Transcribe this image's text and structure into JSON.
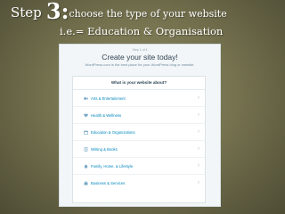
{
  "slide": {
    "step_word": "Step",
    "step_number": "3",
    "step_colon": ":",
    "title_rest": "choose the type of your website",
    "subtitle": "i.e.= Education & Organisation"
  },
  "screenshot": {
    "step_label": "Step 1 of 4",
    "heading": "Create your site today!",
    "tagline": "WordPress.com is the best place for your WordPress blog or website.",
    "question": "What is your website about?",
    "options": [
      {
        "label": "Arts & Entertainment",
        "icon": "video-camera-icon"
      },
      {
        "label": "Health & Wellness",
        "icon": "heart-icon"
      },
      {
        "label": "Education & Organizations",
        "icon": "calendar-icon"
      },
      {
        "label": "Writing & Books",
        "icon": "document-icon"
      },
      {
        "label": "Family, Home, & Lifestyle",
        "icon": "house-icon"
      },
      {
        "label": "Business & Services",
        "icon": "briefcase-icon"
      }
    ],
    "chevron": "›"
  },
  "colors": {
    "slide_background": "#767350",
    "link_blue": "#0087be",
    "heading_text": "#2e4453"
  }
}
